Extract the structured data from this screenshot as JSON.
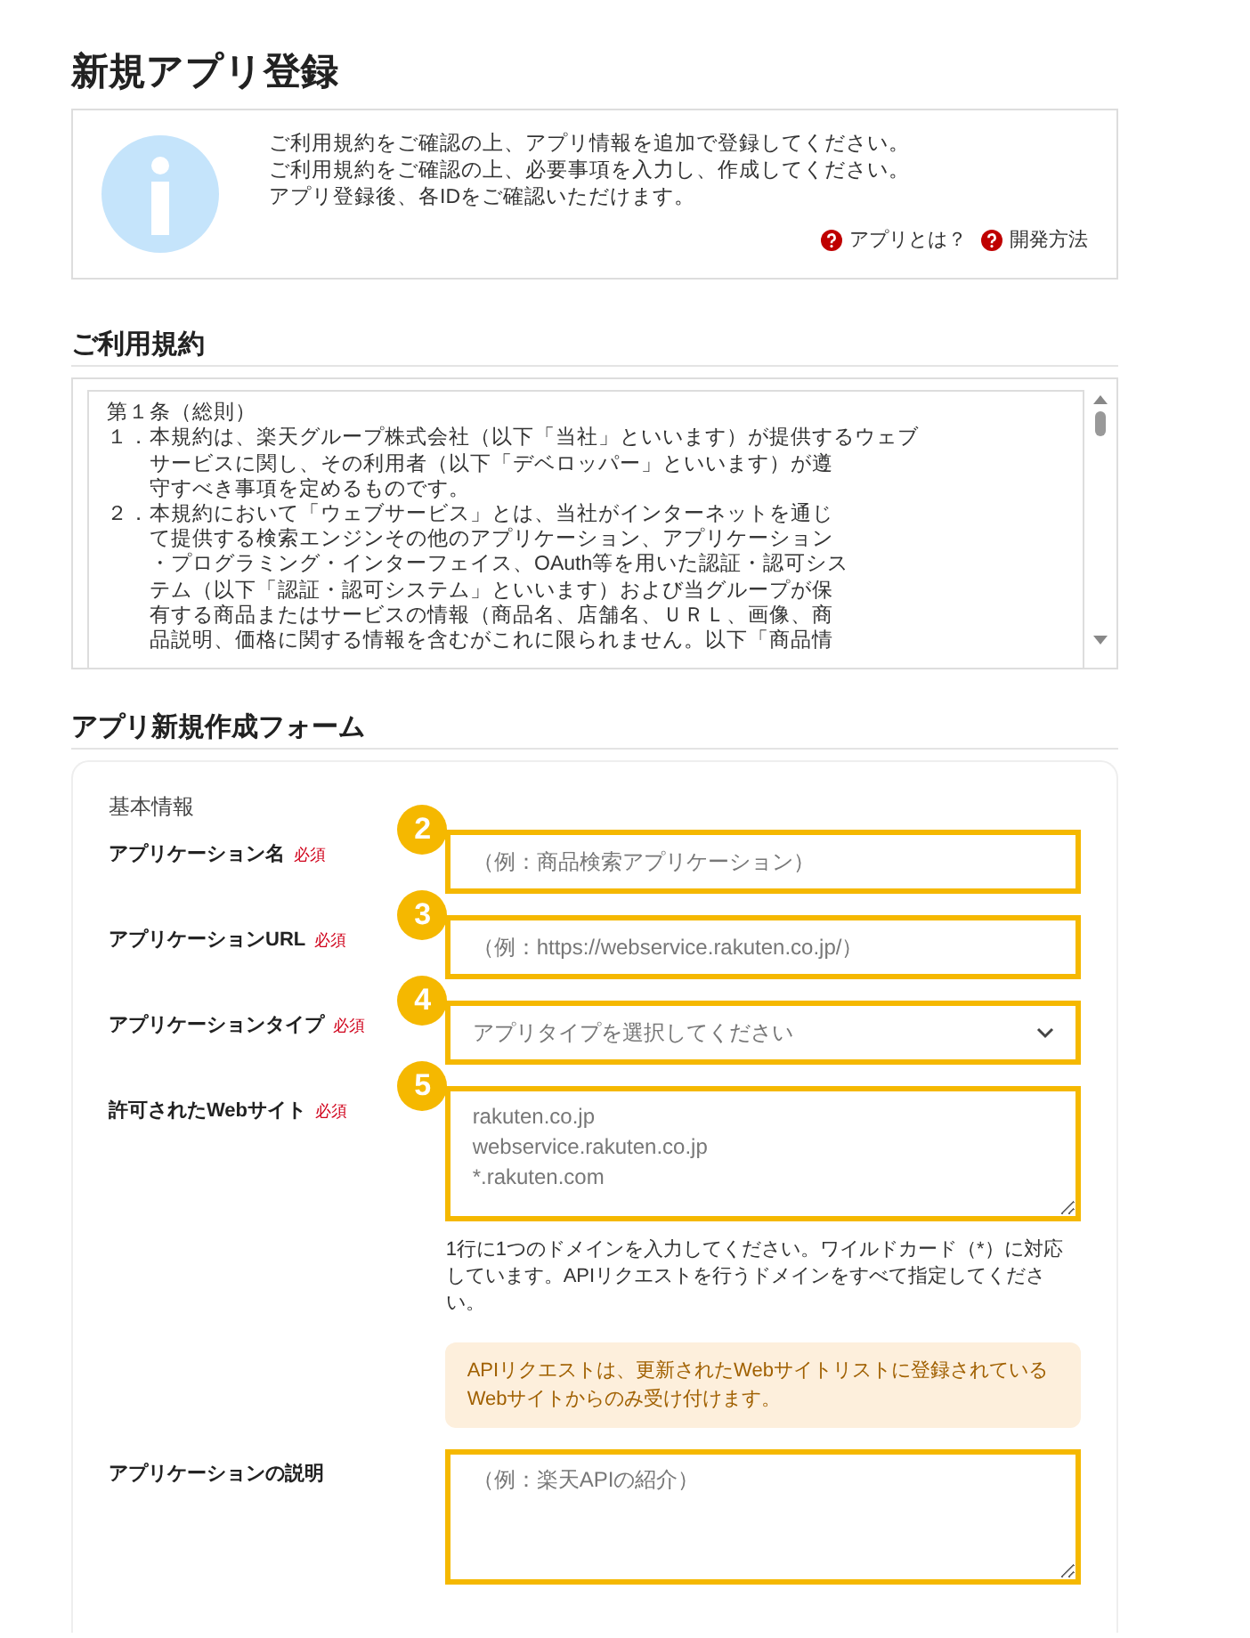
{
  "page_title": "新規アプリ登録",
  "info": {
    "lines": [
      "ご利用規約をご確認の上、アプリ情報を追加で登録してください。",
      "ご利用規約をご確認の上、必要事項を入力し、作成してください。",
      "アプリ登録後、各IDをご確認いただけます。"
    ],
    "links": [
      "アプリとは？",
      "開発方法"
    ]
  },
  "terms": {
    "heading": "ご利用規約",
    "article": "第１条（総則）",
    "clauses": [
      {
        "number": "１．",
        "lines": [
          "本規約は、楽天グループ株式会社（以下「当社」といいます）が提供するウェブ",
          "サービスに関し、その利用者（以下「デベロッパー」といいます）が遵",
          "守すべき事項を定めるものです。"
        ]
      },
      {
        "number": "２．",
        "lines": [
          "本規約において「ウェブサービス」とは、当社がインターネットを通じ",
          "て提供する検索エンジンその他のアプリケーション、アプリケーション",
          "・プログラミング・インターフェイス、OAuth等を用いた認証・認可シス",
          "テム（以下「認証・認可システム」といいます）および当グループが保",
          "有する商品またはサービスの情報（商品名、店舗名、ＵＲＬ、画像、商",
          "品説明、価格に関する情報を含むがこれに限られません。以下「商品情"
        ]
      }
    ]
  },
  "form": {
    "heading": "アプリ新規作成フォーム",
    "section": "基本情報",
    "fields": [
      {
        "kind": "text",
        "label": "アプリケーション名",
        "required": true,
        "required_label": "必須",
        "marker": "2",
        "placeholder": "（例：商品検索アプリケーション）"
      },
      {
        "kind": "text",
        "label": "アプリケーションURL",
        "required": true,
        "required_label": "必須",
        "marker": "3",
        "placeholder": "（例：https://webservice.rakuten.co.jp/）"
      },
      {
        "kind": "select",
        "label": "アプリケーションタイプ",
        "required": true,
        "required_label": "必須",
        "marker": "4",
        "placeholder": "アプリタイプを選択してください"
      },
      {
        "kind": "textarea",
        "label": "許可されたWebサイト",
        "required": true,
        "required_label": "必須",
        "marker": "5",
        "placeholder": "rakuten.co.jp\nwebservice.rakuten.co.jp\n*.rakuten.com",
        "help": "1行に1つのドメインを入力してください。ワイルドカード（*）に対応しています。APIリクエストを行うドメインをすべて指定してください。",
        "notice": "APIリクエストは、更新されたWebサイトリストに登録されているWebサイトからのみ受け付けます。"
      },
      {
        "kind": "textarea",
        "label": "アプリケーションの説明",
        "required": false,
        "placeholder": "（例：楽天APIの紹介）"
      }
    ]
  }
}
